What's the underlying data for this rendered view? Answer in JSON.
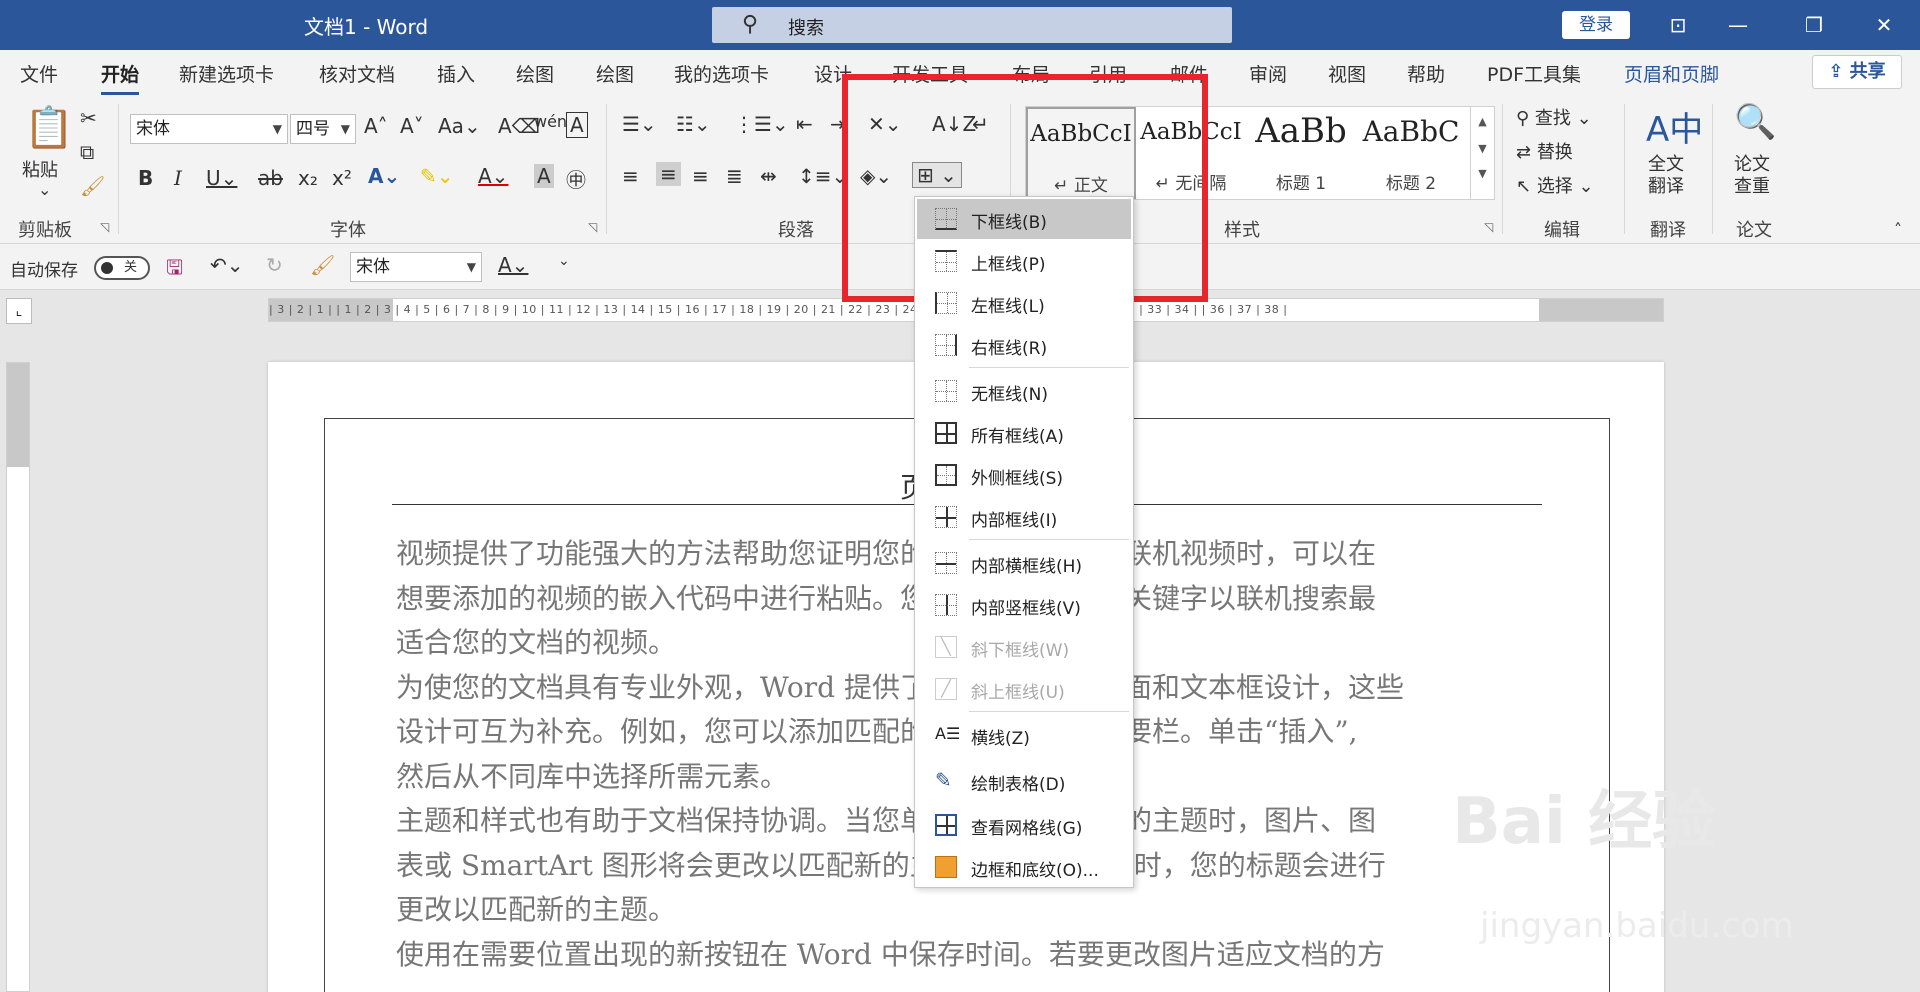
{
  "window": {
    "title": "文档1  -  Word",
    "search_placeholder": "搜索",
    "login": "登录"
  },
  "tabs": [
    "文件",
    "开始",
    "新建选项卡",
    "核对文档",
    "插入",
    "绘图",
    "绘图",
    "我的选项卡",
    "设计",
    "开发工具",
    "布局",
    "引用",
    "邮件",
    "审阅",
    "视图",
    "帮助",
    "PDF工具集",
    "页眉和页脚"
  ],
  "share_label": "共享",
  "ribbon": {
    "clipboard": {
      "paste": "粘贴",
      "group": "剪贴板"
    },
    "font": {
      "name": "宋体",
      "size": "四号",
      "group": "字体"
    },
    "paragraph": {
      "group": "段落"
    },
    "styles": {
      "group": "样式",
      "items": [
        {
          "preview": "AaBbCcI",
          "name": "↵ 正文"
        },
        {
          "preview": "AaBbCcI",
          "name": "↵ 无间隔"
        },
        {
          "preview": "AaBb",
          "name": "标题 1"
        },
        {
          "preview": "AaBbC",
          "name": "标题 2"
        }
      ]
    },
    "editing": {
      "find": "查找",
      "replace": "替换",
      "select": "选择",
      "group": "编辑"
    },
    "translate": {
      "button": "全文\n翻译",
      "group": "翻译"
    },
    "paper": {
      "button": "论文\n查重",
      "group": "论文"
    }
  },
  "qat": {
    "autosave": "自动保存",
    "toggle": "关",
    "font": "宋体"
  },
  "ruler_numbers": "| 3 | 2 | 1 |     | 1 | 2 | 3 | 4 | 5 | 6 | 7 | 8 | 9 | 10 | 11 | 12 | 13 | 14 | 15 | 16 | 17 | 18 | 19 | 20 | 21 | 22 | 23 | 24 | 25 | 26 | 27 | 28 | 29 | 30 | 31 | 32 | 33 | 34 |     | 36 | 37 | 38 |",
  "document": {
    "header_char": "页",
    "lines": [
      "视频提供了功能强大的方法帮助您证明您的观点。当您单击联机视频时，可以在",
      "想要添加的视频的嵌入代码中进行粘贴。您也可以键入一个关键字以联机搜索最",
      "适合您的文档的视频。",
      "为使您的文档具有专业外观，Word 提供了页眉、页脚、封面和文本框设计，这些",
      "设计可互为补充。例如，您可以添加匹配的封面、页眉和提要栏。单击“插入”,",
      "然后从不同库中选择所需元素。",
      "主题和样式也有助于文档保持协调。当您单击设计并选择新的主题时，图片、图",
      "表或 SmartArt 图形将会更改以匹配新的主题。当应用样式时，您的标题会进行",
      "更改以匹配新的主题。",
      "使用在需要位置出现的新按钮在 Word 中保存时间。若要更改图片适应文档的方"
    ]
  },
  "border_menu": [
    {
      "label": "下框线(B)",
      "icon": "bottom-border-icon",
      "state": "highlighted"
    },
    {
      "label": "上框线(P)",
      "icon": "top-border-icon",
      "state": "normal"
    },
    {
      "label": "左框线(L)",
      "icon": "left-border-icon",
      "state": "normal"
    },
    {
      "label": "右框线(R)",
      "icon": "right-border-icon",
      "state": "normal"
    },
    {
      "label": "无框线(N)",
      "icon": "no-border-icon",
      "state": "normal"
    },
    {
      "label": "所有框线(A)",
      "icon": "all-borders-icon",
      "state": "normal"
    },
    {
      "label": "外侧框线(S)",
      "icon": "outside-borders-icon",
      "state": "normal"
    },
    {
      "label": "内部框线(I)",
      "icon": "inside-borders-icon",
      "state": "normal"
    },
    {
      "label": "内部横框线(H)",
      "icon": "inside-horizontal-border-icon",
      "state": "normal"
    },
    {
      "label": "内部竖框线(V)",
      "icon": "inside-vertical-border-icon",
      "state": "normal"
    },
    {
      "label": "斜下框线(W)",
      "icon": "diagonal-down-border-icon",
      "state": "disabled"
    },
    {
      "label": "斜上框线(U)",
      "icon": "diagonal-up-border-icon",
      "state": "disabled"
    },
    {
      "label": "横线(Z)",
      "icon": "horizontal-line-icon",
      "state": "normal"
    },
    {
      "label": "绘制表格(D)",
      "icon": "draw-table-icon",
      "state": "normal"
    },
    {
      "label": "查看网格线(G)",
      "icon": "view-gridlines-icon",
      "state": "normal"
    },
    {
      "label": "边框和底纹(O)...",
      "icon": "borders-shading-icon",
      "state": "normal"
    }
  ],
  "watermark": {
    "brand": "Bai 经验",
    "url": "jingyan.baidu.com"
  },
  "colors": {
    "titlebar": "#2b579a",
    "highlight_box": "#e8242c"
  }
}
